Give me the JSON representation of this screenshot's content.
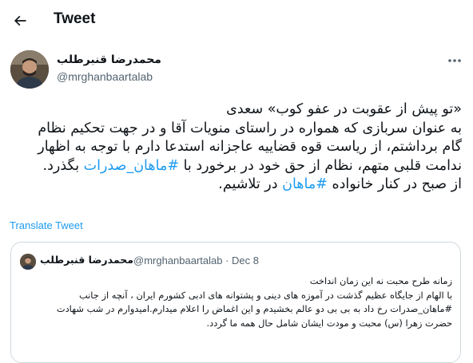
{
  "header": {
    "title": "Tweet"
  },
  "tweet": {
    "author_name": "محمدرضا قنبرطلب",
    "author_handle": "@mrghanbaartalab",
    "lines": {
      "l1": "«تو پیش از عقوبت در عفو کوب» سعدی",
      "l2": "به عنوان سربازی که همواره در راستای منویات آقا و در جهت تحکیم نظام",
      "l3": "گام برداشتم، از ریاست قوه قضاییه عاجزانه استدعا دارم با توجه به اظهار",
      "l4_a": "ندامت قلبی متهم، نظام از حق خود در برخورد با ",
      "l4_tag": "#ماهان_صدرات",
      "l4_b": " بگذرد.",
      "l5_a": "از صبح در کنار خانواده ",
      "l5_tag": "#ماهان",
      "l5_b": " در تلاشیم."
    },
    "translate_label": "Translate Tweet"
  },
  "quote": {
    "author_name": "محمدرضا قنبرطلب",
    "handle_date": "@mrghanbaartalab · Dec 8",
    "lines": [
      "زمانه طرح محبت نه این زمان انداخت",
      "با الهام از جایگاه عظیم گذشت در آموزه های دینی و پشتوانه های ادبی کشورم ایران ، آنچه از جانب",
      "#ماهان_صدرات رخ داد به بی بی دو عالم بخشیدم و این اغماض را اعلام میدارم.امیدوارم در شب شهادت",
      "حضرت زهرا (س) محبت و مودت ایشان شامل حال همه ما گردد."
    ]
  },
  "colors": {
    "accent": "#1d9bf0",
    "text": "#0f1419",
    "secondary": "#536471",
    "border": "#cfd9de"
  },
  "icons": {
    "back": "arrow-left-icon",
    "more": "more-horizontal-icon"
  }
}
